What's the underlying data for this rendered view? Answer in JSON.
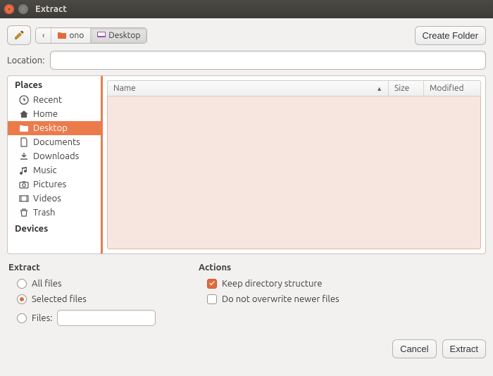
{
  "window": {
    "title": "Extract"
  },
  "toolbar": {
    "create_folder": "Create Folder",
    "breadcrumb": {
      "back": "‹",
      "seg1": "ono",
      "seg2": "Desktop"
    }
  },
  "location": {
    "label": "Location:",
    "value": ""
  },
  "sidebar": {
    "section_places": "Places",
    "section_devices": "Devices",
    "items": [
      {
        "label": "Recent"
      },
      {
        "label": "Home"
      },
      {
        "label": "Desktop"
      },
      {
        "label": "Documents"
      },
      {
        "label": "Downloads"
      },
      {
        "label": "Music"
      },
      {
        "label": "Pictures"
      },
      {
        "label": "Videos"
      },
      {
        "label": "Trash"
      }
    ]
  },
  "columns": {
    "name": "Name",
    "size": "Size",
    "modified": "Modified"
  },
  "extract": {
    "head": "Extract",
    "all_files": "All files",
    "selected_files": "Selected files",
    "files_label": "Files:",
    "files_value": ""
  },
  "actions": {
    "head": "Actions",
    "keep_dir": "Keep directory structure",
    "no_overwrite": "Do not overwrite newer files"
  },
  "buttons": {
    "cancel": "Cancel",
    "extract": "Extract"
  }
}
